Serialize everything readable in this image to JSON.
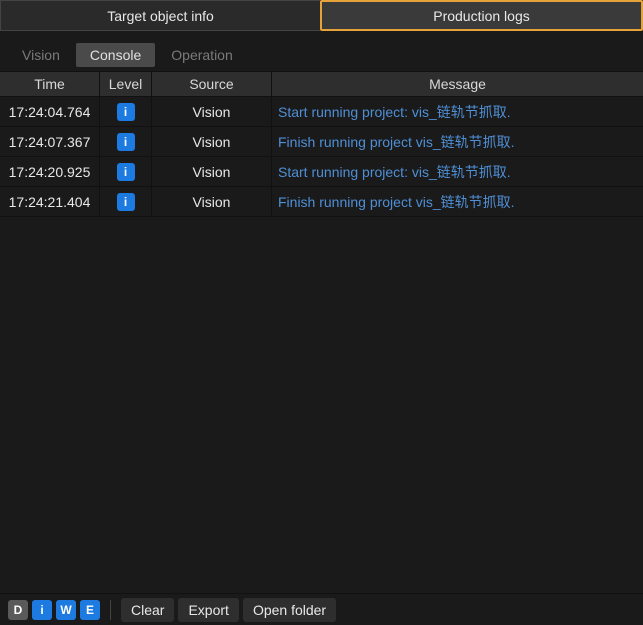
{
  "topTabs": {
    "targetInfo": "Target object info",
    "productionLogs": "Production logs"
  },
  "subTabs": {
    "vision": "Vision",
    "console": "Console",
    "operation": "Operation"
  },
  "columns": {
    "time": "Time",
    "level": "Level",
    "source": "Source",
    "message": "Message"
  },
  "rows": [
    {
      "time": "17:24:04.764",
      "level": "i",
      "source": "Vision",
      "message": "Start running project: vis_链轨节抓取."
    },
    {
      "time": "17:24:07.367",
      "level": "i",
      "source": "Vision",
      "message": "Finish running project vis_链轨节抓取."
    },
    {
      "time": "17:24:20.925",
      "level": "i",
      "source": "Vision",
      "message": "Start running project: vis_链轨节抓取."
    },
    {
      "time": "17:24:21.404",
      "level": "i",
      "source": "Vision",
      "message": "Finish running project vis_链轨节抓取."
    }
  ],
  "filters": {
    "d": "D",
    "i": "i",
    "w": "W",
    "e": "E"
  },
  "footerButtons": {
    "clear": "Clear",
    "export": "Export",
    "openFolder": "Open folder"
  }
}
